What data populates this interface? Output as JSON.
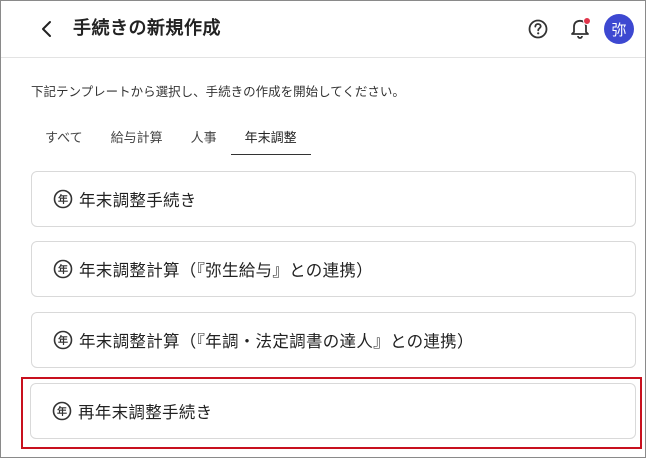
{
  "header": {
    "title": "手続きの新規作成",
    "avatar_text": "弥",
    "icons": {
      "back": "chevron-left-icon",
      "help": "help-circle-icon",
      "notifications": "bell-icon"
    },
    "notification_dot_color": "#e0344a",
    "avatar_color": "#3d48d1"
  },
  "description": "下記テンプレートから選択し、手続きの作成を開始してください。",
  "tabs": [
    {
      "label": "すべて",
      "active": false
    },
    {
      "label": "給与計算",
      "active": false
    },
    {
      "label": "人事",
      "active": false
    },
    {
      "label": "年末調整",
      "active": true
    }
  ],
  "templates": [
    {
      "label": "年末調整手続き",
      "icon": "nen-badge-icon",
      "icon_char": "年"
    },
    {
      "label": "年末調整計算（『弥生給与』との連携）",
      "icon": "nen-badge-icon",
      "icon_char": "年"
    },
    {
      "label": "年末調整計算（『年調・法定調書の達人』との連携）",
      "icon": "nen-badge-icon",
      "icon_char": "年"
    },
    {
      "label": "再年末調整手続き",
      "icon": "nen-badge-icon",
      "icon_char": "年",
      "highlighted": true
    }
  ],
  "highlight_color": "#c8101e"
}
